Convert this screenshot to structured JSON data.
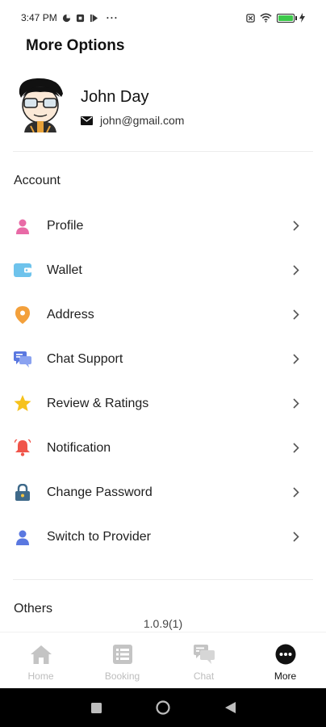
{
  "status_bar": {
    "time": "3:47 PM",
    "overflow": "···"
  },
  "header": {
    "title": "More Options"
  },
  "profile": {
    "name": "John Day",
    "email": "john@gmail.com"
  },
  "sections": {
    "account": "Account",
    "others": "Others"
  },
  "menu": [
    {
      "label": "Profile",
      "icon": "person-icon",
      "color": "#e86aa6"
    },
    {
      "label": "Wallet",
      "icon": "wallet-icon",
      "color": "#6ec3ec"
    },
    {
      "label": "Address",
      "icon": "location-pin-icon",
      "color": "#f3a03b"
    },
    {
      "label": "Chat Support",
      "icon": "chat-support-icon",
      "color": "#5a78e0"
    },
    {
      "label": "Review & Ratings",
      "icon": "star-icon",
      "color": "#f6c21c"
    },
    {
      "label": "Notification",
      "icon": "bell-icon",
      "color": "#f0554a"
    },
    {
      "label": "Change Password",
      "icon": "lock-icon",
      "color": "#3f6a8a"
    },
    {
      "label": "Switch to Provider",
      "icon": "person-switch-icon",
      "color": "#5a78e0"
    }
  ],
  "version": "1.0.9(1)",
  "bottom_nav": [
    {
      "label": "Home",
      "icon": "home-icon"
    },
    {
      "label": "Booking",
      "icon": "booking-list-icon"
    },
    {
      "label": "Chat",
      "icon": "chat-icon"
    },
    {
      "label": "More",
      "icon": "more-dots-icon",
      "active": true
    }
  ]
}
